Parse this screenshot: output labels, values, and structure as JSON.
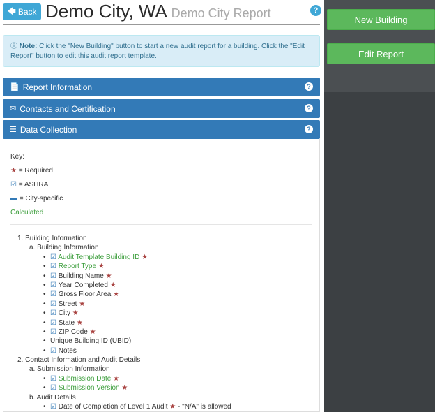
{
  "header": {
    "back_label": "Back",
    "title": "Demo City, WA",
    "subtitle": "Demo City Report"
  },
  "note": {
    "bold": "Note:",
    "text": "Click the \"New Building\" button to start a new audit report for a building. Click the \"Edit Report\" button to edit this audit report template."
  },
  "sidebar": {
    "new_building": "New Building",
    "edit_report": "Edit Report"
  },
  "panels": {
    "report_info": "Report Information",
    "contacts": "Contacts and Certification",
    "data_collection": "Data Collection"
  },
  "key": {
    "title": "Key:",
    "required": "= Required",
    "ashrae": "= ASHRAE",
    "city": "= City-specific",
    "calculated": "Calculated"
  },
  "tree": {
    "s1": "1. Building Information",
    "s1a": "a. Building Information",
    "items1": [
      "Audit Template Building ID",
      "Report Type",
      "Building Name",
      "Year Completed",
      "Gross Floor Area",
      "Street",
      "City",
      "State",
      "ZIP Code",
      "Unique Building ID (UBID)",
      "Notes"
    ],
    "s2": "2. Contact Information and Audit Details",
    "s2a": "a. Submission Information",
    "items2": [
      "Submission Date",
      "Submission Version"
    ],
    "s2b": "b. Audit Details",
    "items3": [
      "Date of Completion of Level 1 Audit"
    ],
    "items3_suffix": "- \"N/A\" is allowed"
  },
  "colors": {
    "primary": "#337ab7",
    "success": "#5cb85c",
    "info_bg": "#d9edf7",
    "required_star": "#a94442",
    "calculated": "#3c9e3c"
  }
}
